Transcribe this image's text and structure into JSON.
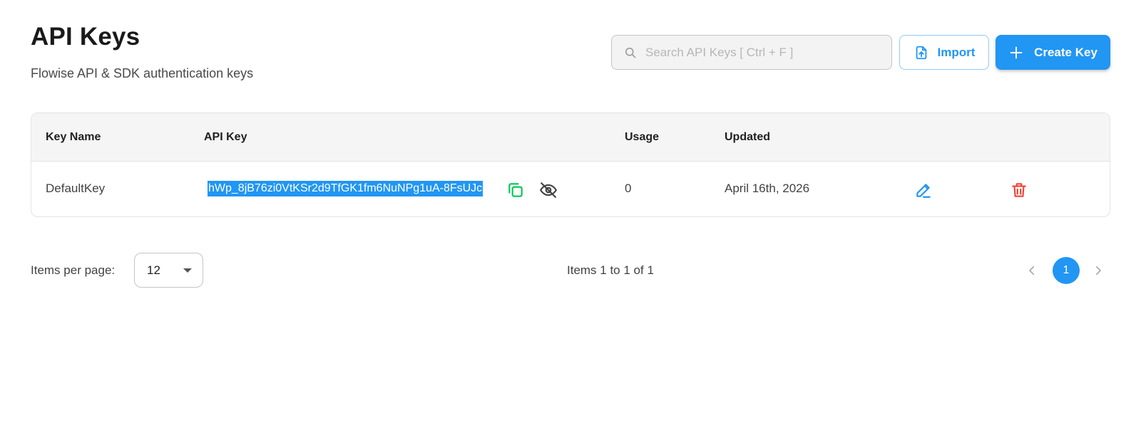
{
  "header": {
    "title": "API Keys",
    "subtitle": "Flowise API & SDK authentication keys"
  },
  "toolbar": {
    "search_placeholder": "Search API Keys [ Ctrl + F ]",
    "search_value": "",
    "import_label": "Import",
    "create_label": "Create Key"
  },
  "table": {
    "columns": [
      "Key Name",
      "API Key",
      "Usage",
      "Updated"
    ],
    "rows": [
      {
        "key_name": "DefaultKey",
        "api_key": "hWp_8jB76zi0VtKSr2d9TfGK1fm6NuNPg1uA-8FsUJc",
        "usage": "0",
        "updated": "April 16th, 2026"
      }
    ]
  },
  "pagination": {
    "items_per_page_label": "Items per page:",
    "items_per_page_value": "12",
    "items_range": "Items 1 to 1 of 1",
    "current_page": "1"
  },
  "icons": {
    "search": "search-icon",
    "import": "file-upload-icon",
    "create": "plus-icon",
    "copy": "copy-icon",
    "visibility": "eye-off-icon",
    "edit": "pencil-icon",
    "delete": "trash-icon",
    "prev": "chevron-left-icon",
    "next": "chevron-right-icon"
  },
  "colors": {
    "primary": "#2196f3",
    "copy": "#00c853",
    "delete": "#f44336",
    "selection": "#2196f3"
  }
}
